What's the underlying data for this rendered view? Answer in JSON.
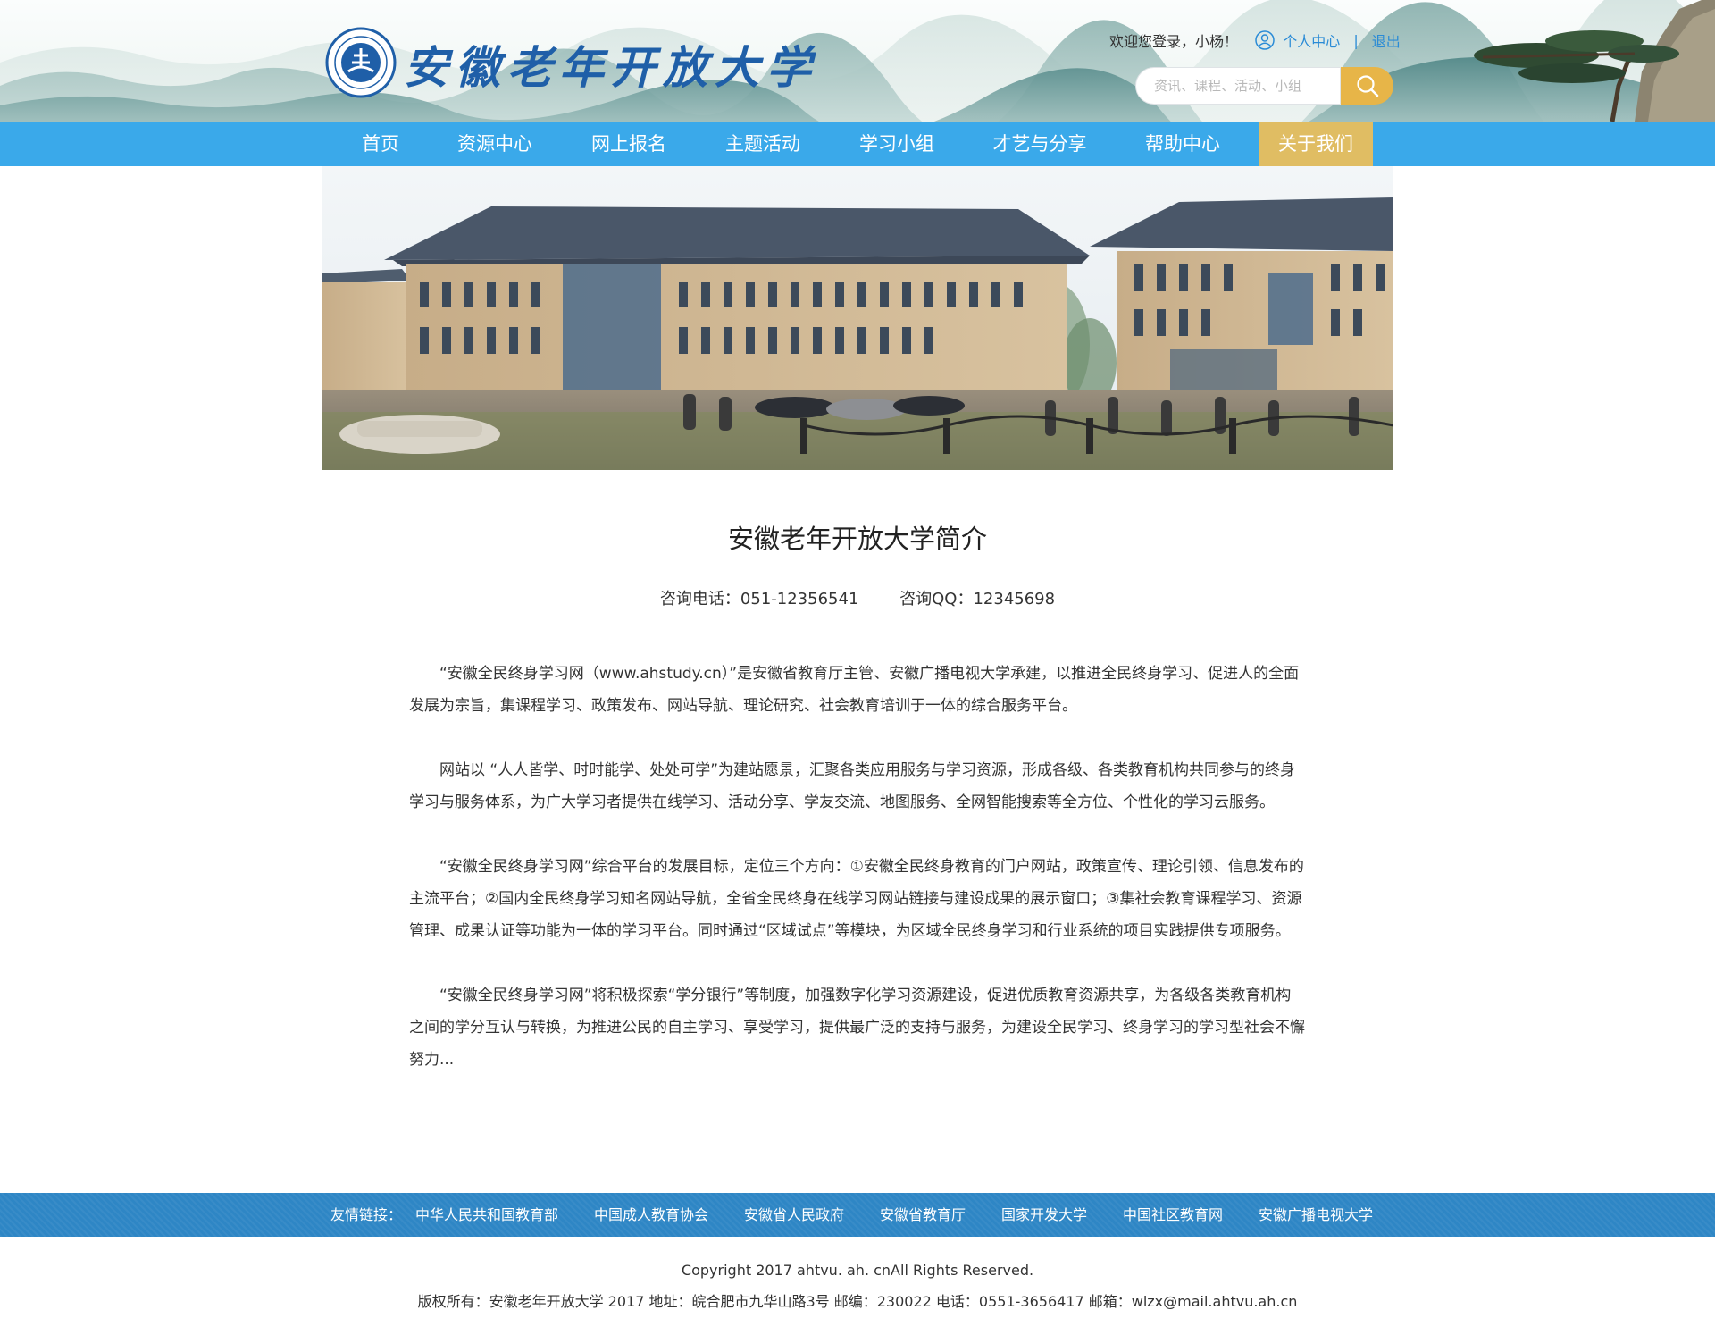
{
  "header": {
    "site_title": "安徽老年开放大学",
    "logo_icon": "university-seal-icon",
    "user": {
      "greeting": "欢迎您登录，小杨！",
      "profile_label": "个人中心",
      "separator": "|",
      "logout_label": "退出"
    },
    "search": {
      "placeholder": "资讯、课程、活动、小组",
      "button_icon": "search-icon"
    }
  },
  "nav": {
    "items": [
      {
        "label": "首页"
      },
      {
        "label": "资源中心"
      },
      {
        "label": "网上报名"
      },
      {
        "label": "主题活动"
      },
      {
        "label": "学习小组"
      },
      {
        "label": "才艺与分享"
      },
      {
        "label": "帮助中心"
      },
      {
        "label": "关于我们",
        "active": true
      }
    ],
    "bar_color": "#3aa9ea",
    "active_color": "#e0bd63"
  },
  "article": {
    "title": "安徽老年开放大学简介",
    "phone": "咨询电话：051-12356541",
    "qq": "咨询QQ：12345698",
    "paragraphs": [
      "“安徽全民终身学习网（www.ahstudy.cn）”是安徽省教育厅主管、安徽广播电视大学承建，以推进全民终身学习、促进人的全面发展为宗旨，集课程学习、政策发布、网站导航、理论研究、社会教育培训于一体的综合服务平台。",
      "网站以 “人人皆学、时时能学、处处可学”为建站愿景，汇聚各类应用服务与学习资源，形成各级、各类教育机构共同参与的终身学习与服务体系，为广大学习者提供在线学习、活动分享、学友交流、地图服务、全网智能搜索等全方位、个性化的学习云服务。",
      "“安徽全民终身学习网”综合平台的发展目标，定位三个方向：①安徽全民终身教育的门户网站，政策宣传、理论引领、信息发布的主流平台；②国内全民终身学习知名网站导航，全省全民终身在线学习网站链接与建设成果的展示窗口；③集社会教育课程学习、资源管理、成果认证等功能为一体的学习平台。同时通过“区域试点”等模块，为区域全民终身学习和行业系统的项目实践提供专项服务。",
      "“安徽全民终身学习网”将积极探索“学分银行”等制度，加强数字化学习资源建设，促进优质教育资源共享，为各级各类教育机构之间的学分互认与转换，为推进公民的自主学习、享受学习，提供最广泛的支持与服务，为建设全民学习、终身学习的学习型社会不懈努力..."
    ]
  },
  "footer": {
    "links_label": "友情链接：",
    "links": [
      "中华人民共和国教育部",
      "中国成人教育协会",
      "安徽省人民政府",
      "安徽省教育厅",
      "国家开发大学",
      "中国社区教育网",
      "安徽广播电视大学"
    ],
    "copyright": "Copyright 2017 ahtvu. ah. cnAll Rights Reserved.",
    "info": "版权所有：安徽老年开放大学 2017 地址：皖合肥市九华山路3号 邮编：230022 电话：0551-3656417 邮箱：wlzx@mail.ahtvu.ah.cn"
  }
}
